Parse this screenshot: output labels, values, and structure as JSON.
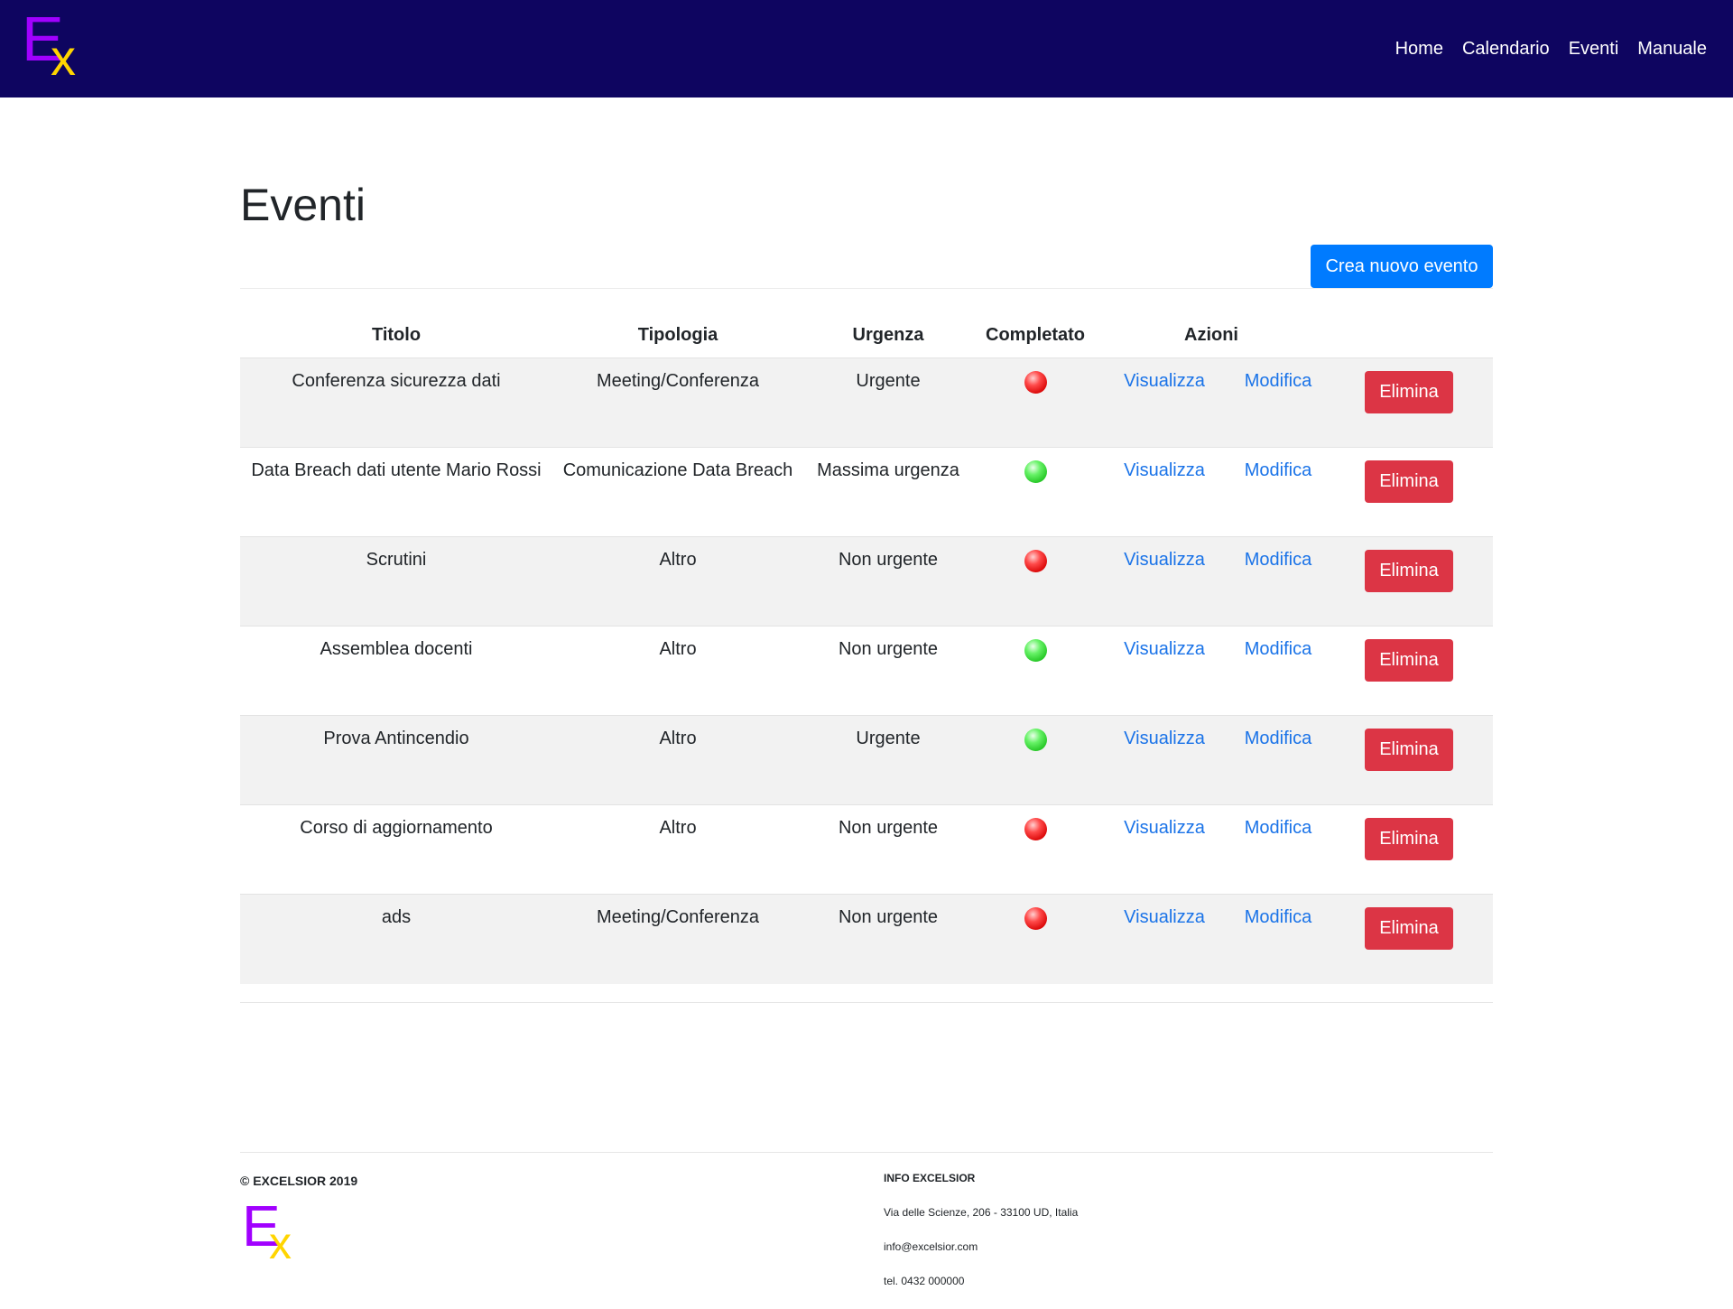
{
  "brand": {
    "logo_letter_e": "E",
    "logo_letter_x": "x"
  },
  "nav": {
    "items": [
      "Home",
      "Calendario",
      "Eventi",
      "Manuale"
    ]
  },
  "page": {
    "title": "Eventi",
    "create_button": "Crea nuovo evento"
  },
  "table": {
    "headers": [
      "Titolo",
      "Tipologia",
      "Urgenza",
      "Completato",
      "Azioni"
    ],
    "rows": [
      {
        "titolo": "Conferenza sicurezza dati",
        "tipologia": "Meeting/Conferenza",
        "urgenza": "Urgente",
        "completato": "red"
      },
      {
        "titolo": "Data Breach dati utente Mario Rossi",
        "tipologia": "Comunicazione Data Breach",
        "urgenza": "Massima urgenza",
        "completato": "green"
      },
      {
        "titolo": "Scrutini",
        "tipologia": "Altro",
        "urgenza": "Non urgente",
        "completato": "red"
      },
      {
        "titolo": "Assemblea docenti",
        "tipologia": "Altro",
        "urgenza": "Non urgente",
        "completato": "green"
      },
      {
        "titolo": "Prova Antincendio",
        "tipologia": "Altro",
        "urgenza": "Urgente",
        "completato": "green"
      },
      {
        "titolo": "Corso di aggiornamento",
        "tipologia": "Altro",
        "urgenza": "Non urgente",
        "completato": "red"
      },
      {
        "titolo": "ads",
        "tipologia": "Meeting/Conferenza",
        "urgenza": "Non urgente",
        "completato": "red"
      }
    ],
    "actions": {
      "view": "Visualizza",
      "edit": "Modifica",
      "delete": "Elimina"
    }
  },
  "footer": {
    "copyright": "© EXCELSIOR 2019",
    "info_title": "INFO EXCELSIOR",
    "address": "Via delle Scienze, 206 - 33100 UD, Italia",
    "email": "info@excelsior.com",
    "phone": "tel. 0432 000000"
  },
  "colors": {
    "navbar": "#0e0560",
    "primary": "#007bff",
    "danger": "#dc3545",
    "link": "#1a73e8",
    "logo_e": "#a100ff",
    "logo_x": "#ffd500"
  }
}
